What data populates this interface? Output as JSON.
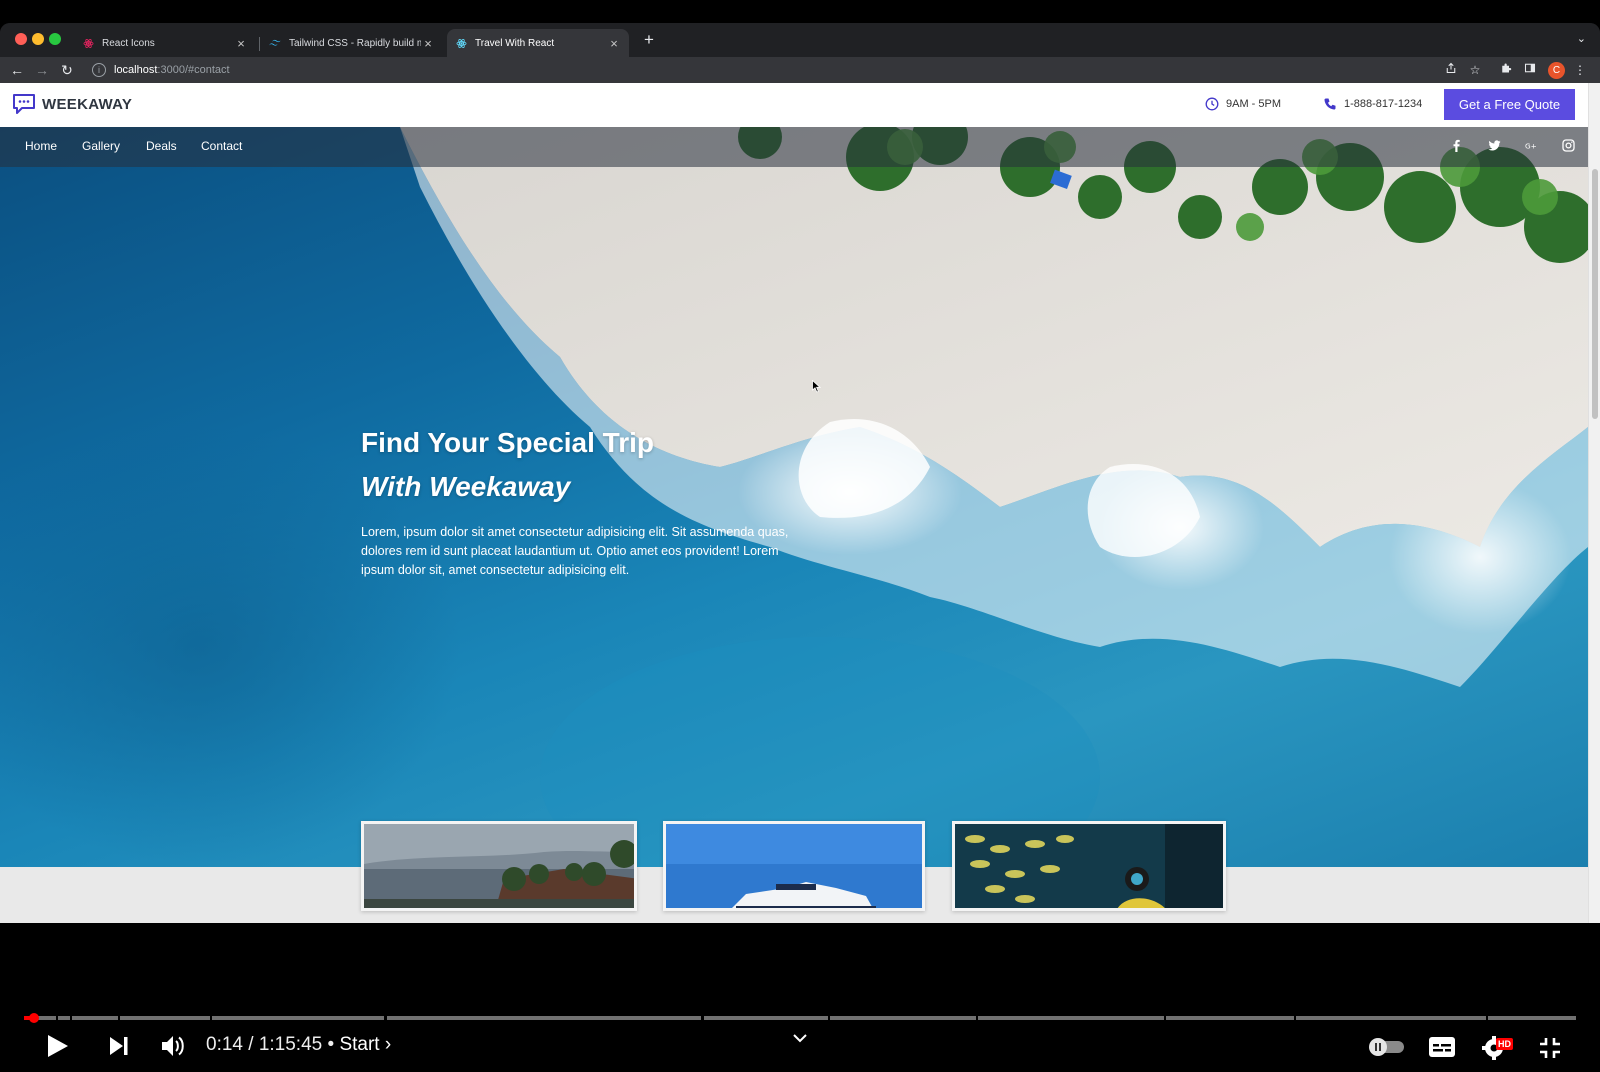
{
  "browser": {
    "tabs": [
      {
        "title": "React Icons",
        "active": false
      },
      {
        "title": "Tailwind CSS - Rapidly build m",
        "active": false
      },
      {
        "title": "Travel With React",
        "active": true
      }
    ],
    "new_tab_label": "+",
    "url_host": "localhost",
    "url_path": ":3000/#contact",
    "profile_initial": "C"
  },
  "site": {
    "brand": "WEEKAWAY",
    "hours": "9AM - 5PM",
    "phone": "1-888-817-1234",
    "cta_label": "Get a Free Quote",
    "nav": [
      "Home",
      "Gallery",
      "Deals",
      "Contact"
    ],
    "hero": {
      "title_line1": "Find Your Special Trip",
      "title_line2": "With Weekaway",
      "body": "Lorem, ipsum dolor sit amet consectetur adipisicing elit. Sit assumenda quas, dolores rem id sunt placeat laudantium ut. Optio amet eos provident! Lorem ipsum dolor sit, amet consectetur adipisicing elit."
    },
    "colors": {
      "accent": "#5b4ce0"
    }
  },
  "player": {
    "current_time": "0:14",
    "duration": "1:15:45",
    "chapter": "Start",
    "separator": "/",
    "bullet": "•",
    "played_fraction": 0.003,
    "hd_badge": "HD"
  }
}
